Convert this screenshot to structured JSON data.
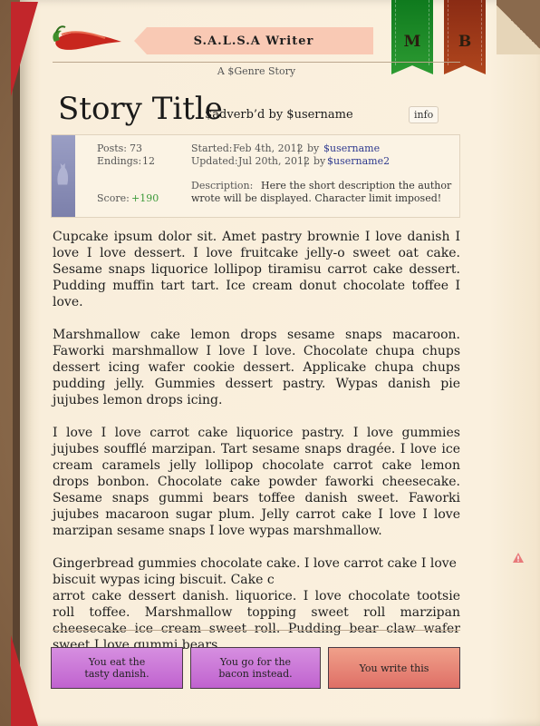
{
  "header": {
    "app_title": "S.A.L.S.A  Writer",
    "subtitle": "A $Genre Story",
    "bookmarks": [
      {
        "label": "M",
        "color": "#1f8b27"
      },
      {
        "label": "B",
        "color": "#a0391a"
      }
    ]
  },
  "story": {
    "title": "Story Title",
    "byline": "$adverb’d by $username",
    "info_tag": "info"
  },
  "info_card": {
    "posts_label": "Posts:",
    "posts_value": "73",
    "endings_label": "Endings:",
    "endings_value": "12",
    "score_label": "Score:",
    "score_value": "+190",
    "started_label": "Started:",
    "started_date": "Feb 4th, 2012",
    "started_by": "by",
    "started_user": "$username",
    "updated_label": "Updated:",
    "updated_date": "Jul 20th, 2012",
    "updated_by": "by",
    "updated_user": "$username2",
    "separator": "|",
    "description_label": "Description:",
    "description_text": "Here the short description the author",
    "description_text2": "wrote will be displayed. Character limit imposed!"
  },
  "body": {
    "paragraphs": [
      "Cupcake ipsum dolor sit. Amet pastry brownie I love danish I love I love dessert. I love fruitcake jelly-o sweet oat cake. Sesame snaps liquorice lollipop tiramisu carrot cake dessert. Pudding muffin tart tart. Ice cream donut chocolate toffee I love.",
      "Marshmallow cake lemon drops sesame snaps macaroon. Faworki marshmallow I love I love. Chocolate chupa chups dessert icing wafer cookie dessert. Applicake chupa chups pudding jelly. Gummies dessert pastry. Wypas danish pie jujubes lemon drops icing.",
      "I love I love carrot cake liquorice pastry. I love gummies jujubes soufflé marzipan. Tart sesame snaps dragée. I love ice cream caramels jelly lollipop chocolate carrot cake lemon drops bonbon. Chocolate cake powder faworki cheesecake. Sesame snaps gummi bears toffee danish sweet. Faworki jujubes macaroon sugar plum. Jelly carrot cake I love I love marzipan sesame snaps I love wypas marshmallow.",
      "Gingerbread gummies chocolate cake. I love carrot cake I love biscuit wypas icing biscuit. Cake c",
      "arrot cake dessert danish. liquorice. I love chocolate tootsie roll toffee. Marshmallow topping sweet roll marzipan cheesecake ice cream sweet roll. Pudding bear claw wafer sweet I love gummi bears"
    ]
  },
  "choices": [
    {
      "line1": "You eat the",
      "line2": "tasty danish."
    },
    {
      "line1": "You go for the",
      "line2": "bacon instead."
    },
    {
      "line1": "You write this",
      "line2": ""
    }
  ],
  "colors": {
    "accent_red": "#c2262b",
    "choice_purple": "#c062cf",
    "choice_coral": "#df6f66",
    "score_green": "#3c9a3a",
    "link_blue": "#2f3a8f"
  }
}
